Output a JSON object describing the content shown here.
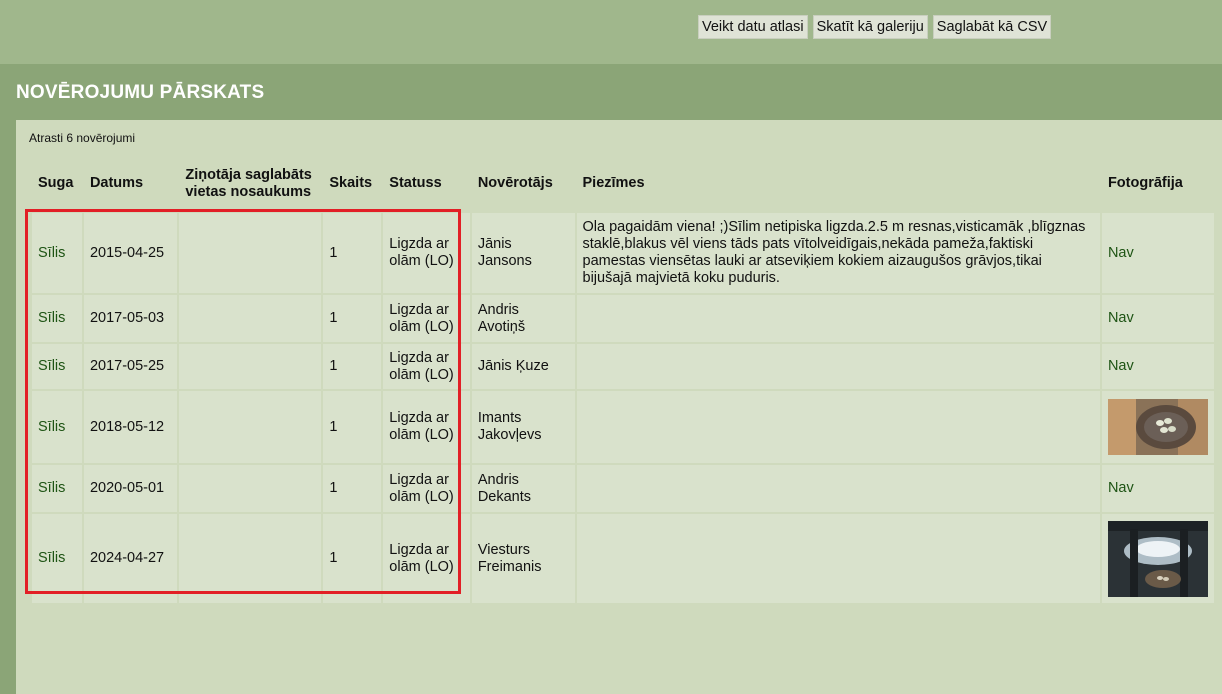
{
  "toolbar": {
    "buttons": [
      "Veikt datu atlasi",
      "Skatīt kā galeriju",
      "Saglabāt kā CSV"
    ]
  },
  "page_title": "NOVĒROJUMU PĀRSKATS",
  "found_text": "Atrasti 6 novērojumi",
  "table": {
    "headers": [
      "Suga",
      "Datums",
      "Ziņotāja saglabāts vietas nosaukums",
      "Skaits",
      "Statuss",
      "Novērotājs",
      "Piezīmes",
      "Fotogrāfija"
    ],
    "rows": [
      {
        "species": "Sīlis",
        "date": "2015-04-25",
        "place": "",
        "count": "1",
        "status": "Ligzda ar olām (LO)",
        "observer": "Jānis Jansons",
        "notes": "Ola pagaidām viena! ;)Sīlim netipiska ligzda.2.5 m resnas,visticamāk ,blīgznas staklē,blakus vēl viens tāds pats vītolveidīgais,nekāda pameža,faktiski pamestas viensētas lauki ar atseviķiem kokiem aizaugušos grāvjos,tikai bijušajā majvietā koku puduris.",
        "photo": "Nav"
      },
      {
        "species": "Sīlis",
        "date": "2017-05-03",
        "place": "",
        "count": "1",
        "status": "Ligzda ar olām (LO)",
        "observer": "Andris Avotiņš",
        "notes": "",
        "photo": "Nav"
      },
      {
        "species": "Sīlis",
        "date": "2017-05-25",
        "place": "",
        "count": "1",
        "status": "Ligzda ar olām (LO)",
        "observer": "Jānis Ķuze",
        "notes": "",
        "photo": "Nav"
      },
      {
        "species": "Sīlis",
        "date": "2018-05-12",
        "place": "",
        "count": "1",
        "status": "Ligzda ar olām (LO)",
        "observer": "Imants Jakovļevs",
        "notes": "",
        "photo": ""
      },
      {
        "species": "Sīlis",
        "date": "2020-05-01",
        "place": "",
        "count": "1",
        "status": "Ligzda ar olām (LO)",
        "observer": "Andris Dekants",
        "notes": "",
        "photo": "Nav"
      },
      {
        "species": "Sīlis",
        "date": "2024-04-27",
        "place": "",
        "count": "1",
        "status": "Ligzda ar olām (LO)",
        "observer": "Viesturs Freimanis",
        "notes": "",
        "photo": ""
      }
    ]
  },
  "colors": {
    "header_bg": "#a0b78c",
    "title_bg": "#8ba577",
    "content_bg": "#cfdabd",
    "cell_bg": "#d9e2cc",
    "link": "#1e5414",
    "highlight": "#e21f26"
  }
}
